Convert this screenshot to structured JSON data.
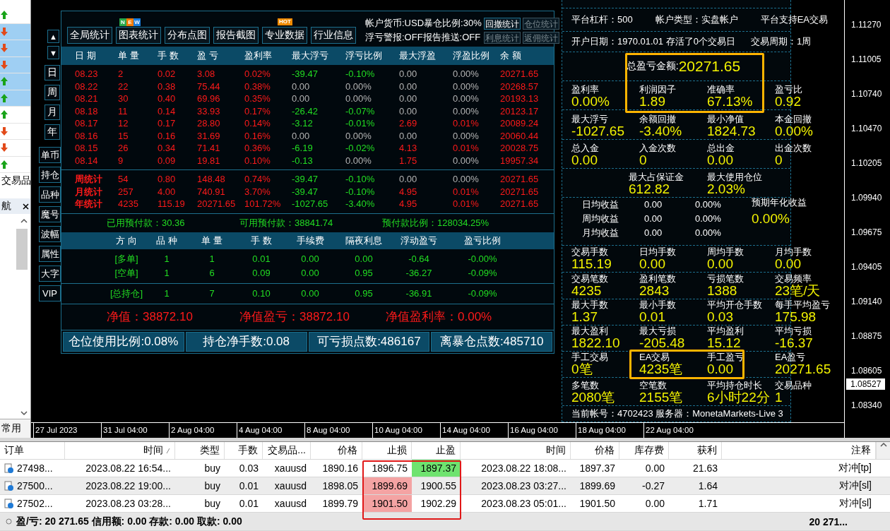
{
  "market_rows": [
    {
      "kind": "up",
      "selected": false
    },
    {
      "kind": "down",
      "selected": true
    },
    {
      "kind": "down",
      "selected": true
    },
    {
      "kind": "down",
      "selected": true
    },
    {
      "kind": "up",
      "selected": true
    },
    {
      "kind": "up",
      "selected": true
    },
    {
      "kind": "up",
      "selected": false
    },
    {
      "kind": "down",
      "selected": false
    },
    {
      "kind": "down",
      "selected": false
    },
    {
      "kind": "up",
      "selected": false
    }
  ],
  "navigator": {
    "symbols_tab": "交易品",
    "nav_tab": "航",
    "bottom_tab": "常用"
  },
  "scroll_buttons": [
    "▲",
    "▼"
  ],
  "period_tabs": [
    "日",
    "周",
    "月",
    "年"
  ],
  "view_tabs": [
    "单币",
    "持仓",
    "品种",
    "魔号",
    "波幅",
    "属性",
    "大字",
    "VIP"
  ],
  "toolbar": [
    {
      "label": "全局统计"
    },
    {
      "label": "图表统计",
      "badge": {
        "kind": "new",
        "letters": [
          {
            "text": "N",
            "color": "#2aa84a"
          },
          {
            "text": "E",
            "color": "#f07a00"
          },
          {
            "text": "W",
            "color": "#1a7fe0"
          }
        ]
      }
    },
    {
      "label": "分布点图"
    },
    {
      "label": "报告截图"
    },
    {
      "label": "专业数据",
      "badge": {
        "kind": "hot",
        "text": "HOT"
      }
    },
    {
      "label": "行业信息"
    }
  ],
  "account_info": [
    "帐户货币:USD暴仓比例:30%",
    "浮亏警报:OFF报告推送:OFF"
  ],
  "report_buttons": [
    {
      "label": "回撤统计",
      "disabled": false
    },
    {
      "label": "仓位统计",
      "disabled": true
    },
    {
      "label": "利息统计",
      "disabled": true
    },
    {
      "label": "返佣统计",
      "disabled": true
    }
  ],
  "stats": {
    "columns": [
      "日 期",
      "单 量",
      "手 数",
      "盈 亏",
      "盈利率",
      "最大浮亏",
      "浮亏比例",
      "最大浮盈",
      "浮盈比例",
      "余 额"
    ],
    "daily": [
      [
        {
          "text": "08.23",
          "color": "#ff1a1a"
        },
        {
          "text": "2",
          "color": "#ff1a1a"
        },
        {
          "text": "0.02",
          "color": "#ff1a1a"
        },
        {
          "text": "3.08",
          "color": "#ff1a1a"
        },
        {
          "text": "0.02%",
          "color": "#ff1a1a"
        },
        {
          "text": "-39.47",
          "color": "#22dd22"
        },
        {
          "text": "-0.10%",
          "color": "#22dd22"
        },
        {
          "text": "0.00",
          "color": "#b4b4b4"
        },
        {
          "text": "0.00%",
          "color": "#b4b4b4"
        },
        {
          "text": "20271.65",
          "color": "#ff1a1a"
        }
      ],
      [
        {
          "text": "08.22",
          "color": "#ff1a1a"
        },
        {
          "text": "22",
          "color": "#ff1a1a"
        },
        {
          "text": "0.38",
          "color": "#ff1a1a"
        },
        {
          "text": "75.44",
          "color": "#ff1a1a"
        },
        {
          "text": "0.38%",
          "color": "#ff1a1a"
        },
        {
          "text": "0.00",
          "color": "#b4b4b4"
        },
        {
          "text": "0.00%",
          "color": "#b4b4b4"
        },
        {
          "text": "0.00",
          "color": "#b4b4b4"
        },
        {
          "text": "0.00%",
          "color": "#b4b4b4"
        },
        {
          "text": "20268.57",
          "color": "#ff1a1a"
        }
      ],
      [
        {
          "text": "08.21",
          "color": "#ff1a1a"
        },
        {
          "text": "30",
          "color": "#ff1a1a"
        },
        {
          "text": "0.40",
          "color": "#ff1a1a"
        },
        {
          "text": "69.96",
          "color": "#ff1a1a"
        },
        {
          "text": "0.35%",
          "color": "#ff1a1a"
        },
        {
          "text": "0.00",
          "color": "#b4b4b4"
        },
        {
          "text": "0.00%",
          "color": "#b4b4b4"
        },
        {
          "text": "0.00",
          "color": "#b4b4b4"
        },
        {
          "text": "0.00%",
          "color": "#b4b4b4"
        },
        {
          "text": "20193.13",
          "color": "#ff1a1a"
        }
      ],
      [
        {
          "text": "08.18",
          "color": "#ff1a1a"
        },
        {
          "text": "11",
          "color": "#ff1a1a"
        },
        {
          "text": "0.14",
          "color": "#ff1a1a"
        },
        {
          "text": "33.93",
          "color": "#ff1a1a"
        },
        {
          "text": "0.17%",
          "color": "#ff1a1a"
        },
        {
          "text": "-26.42",
          "color": "#22dd22"
        },
        {
          "text": "-0.07%",
          "color": "#22dd22"
        },
        {
          "text": "0.00",
          "color": "#b4b4b4"
        },
        {
          "text": "0.00%",
          "color": "#b4b4b4"
        },
        {
          "text": "20123.17",
          "color": "#ff1a1a"
        }
      ],
      [
        {
          "text": "08.17",
          "color": "#ff1a1a"
        },
        {
          "text": "12",
          "color": "#ff1a1a"
        },
        {
          "text": "0.17",
          "color": "#ff1a1a"
        },
        {
          "text": "28.80",
          "color": "#ff1a1a"
        },
        {
          "text": "0.14%",
          "color": "#ff1a1a"
        },
        {
          "text": "-3.12",
          "color": "#22dd22"
        },
        {
          "text": "-0.01%",
          "color": "#22dd22"
        },
        {
          "text": "2.69",
          "color": "#ff1a1a"
        },
        {
          "text": "0.01%",
          "color": "#ff1a1a"
        },
        {
          "text": "20089.24",
          "color": "#ff1a1a"
        }
      ],
      [
        {
          "text": "08.16",
          "color": "#ff1a1a"
        },
        {
          "text": "15",
          "color": "#ff1a1a"
        },
        {
          "text": "0.16",
          "color": "#ff1a1a"
        },
        {
          "text": "31.69",
          "color": "#ff1a1a"
        },
        {
          "text": "0.16%",
          "color": "#ff1a1a"
        },
        {
          "text": "0.00",
          "color": "#b4b4b4"
        },
        {
          "text": "0.00%",
          "color": "#b4b4b4"
        },
        {
          "text": "0.00",
          "color": "#b4b4b4"
        },
        {
          "text": "0.00%",
          "color": "#b4b4b4"
        },
        {
          "text": "20060.44",
          "color": "#ff1a1a"
        }
      ],
      [
        {
          "text": "08.15",
          "color": "#ff1a1a"
        },
        {
          "text": "26",
          "color": "#ff1a1a"
        },
        {
          "text": "0.34",
          "color": "#ff1a1a"
        },
        {
          "text": "71.41",
          "color": "#ff1a1a"
        },
        {
          "text": "0.36%",
          "color": "#ff1a1a"
        },
        {
          "text": "-6.19",
          "color": "#22dd22"
        },
        {
          "text": "-0.02%",
          "color": "#22dd22"
        },
        {
          "text": "4.13",
          "color": "#ff1a1a"
        },
        {
          "text": "0.01%",
          "color": "#ff1a1a"
        },
        {
          "text": "20028.75",
          "color": "#ff1a1a"
        }
      ],
      [
        {
          "text": "08.14",
          "color": "#ff1a1a"
        },
        {
          "text": "9",
          "color": "#ff1a1a"
        },
        {
          "text": "0.09",
          "color": "#ff1a1a"
        },
        {
          "text": "19.81",
          "color": "#ff1a1a"
        },
        {
          "text": "0.10%",
          "color": "#ff1a1a"
        },
        {
          "text": "-0.13",
          "color": "#22dd22"
        },
        {
          "text": "0.00%",
          "color": "#b4b4b4"
        },
        {
          "text": "1.75",
          "color": "#ff1a1a"
        },
        {
          "text": "0.00%",
          "color": "#b4b4b4"
        },
        {
          "text": "19957.34",
          "color": "#ff1a1a"
        }
      ]
    ],
    "summary": [
      [
        {
          "text": "周统计",
          "color": "#ff1a1a"
        },
        {
          "text": "54",
          "color": "#ff1a1a"
        },
        {
          "text": "0.80",
          "color": "#ff1a1a"
        },
        {
          "text": "148.48",
          "color": "#ff1a1a"
        },
        {
          "text": "0.74%",
          "color": "#ff1a1a"
        },
        {
          "text": "-39.47",
          "color": "#22dd22"
        },
        {
          "text": "-0.10%",
          "color": "#22dd22"
        },
        {
          "text": "0.00",
          "color": "#b4b4b4"
        },
        {
          "text": "0.00%",
          "color": "#b4b4b4"
        },
        {
          "text": "20271.65",
          "color": "#ff1a1a"
        }
      ],
      [
        {
          "text": "月统计",
          "color": "#ff1a1a"
        },
        {
          "text": "257",
          "color": "#ff1a1a"
        },
        {
          "text": "4.00",
          "color": "#ff1a1a"
        },
        {
          "text": "740.91",
          "color": "#ff1a1a"
        },
        {
          "text": "3.70%",
          "color": "#ff1a1a"
        },
        {
          "text": "-39.47",
          "color": "#22dd22"
        },
        {
          "text": "-0.10%",
          "color": "#22dd22"
        },
        {
          "text": "4.95",
          "color": "#ff1a1a"
        },
        {
          "text": "0.01%",
          "color": "#ff1a1a"
        },
        {
          "text": "20271.65",
          "color": "#ff1a1a"
        }
      ],
      [
        {
          "text": "年统计",
          "color": "#ff1a1a"
        },
        {
          "text": "4235",
          "color": "#ff1a1a"
        },
        {
          "text": "115.19",
          "color": "#ff1a1a"
        },
        {
          "text": "20271.65",
          "color": "#ff1a1a"
        },
        {
          "text": "101.72%",
          "color": "#ff1a1a"
        },
        {
          "text": "-1027.65",
          "color": "#22dd22"
        },
        {
          "text": "-3.40%",
          "color": "#22dd22"
        },
        {
          "text": "4.95",
          "color": "#ff1a1a"
        },
        {
          "text": "0.01%",
          "color": "#ff1a1a"
        },
        {
          "text": "20271.65",
          "color": "#ff1a1a"
        }
      ]
    ]
  },
  "margin": [
    "已用预付款：30.36",
    "可用预付款：38841.74",
    "预付款比例：128034.25%"
  ],
  "positions": {
    "columns": [
      "方 向",
      "品 种",
      "单 量",
      "手 数",
      "手续费",
      "隔夜利息",
      "浮动盈亏",
      "盈亏比例"
    ],
    "rows": [
      [
        "[多单]",
        "1",
        "1",
        "0.01",
        "0.00",
        "0.00",
        "-0.64",
        "-0.00%"
      ],
      [
        "[空单]",
        "1",
        "6",
        "0.09",
        "0.00",
        "0.95",
        "-36.27",
        "-0.09%"
      ]
    ],
    "total": [
      "[总持仓]",
      "1",
      "7",
      "0.10",
      "0.00",
      "0.95",
      "-36.91",
      "-0.09%"
    ]
  },
  "equity": [
    "净值：38872.10",
    "净值盈亏：38872.10",
    "净值盈利率：0.00%"
  ],
  "gauges": [
    "仓位使用比例:0.08%",
    "持仓净手数:0.08",
    "可亏损点数:486167",
    "离暴仓点数:485710"
  ],
  "right_panel": {
    "platform": [
      "平台杠杆：500",
      "帐户类型：实盘帐户",
      "平台支持EA交易"
    ],
    "account_age": [
      "开户日期：1970.01.01 存活了0个交易日",
      "交易周期：1周"
    ],
    "total": {
      "label": "总盈亏金额:",
      "value": "20271.65"
    },
    "metric_rows": [
      [
        {
          "label": "盈利率",
          "value": "0.00%"
        },
        {
          "label": "利润因子",
          "value": "1.89"
        },
        {
          "label": "准确率",
          "value": "67.13%"
        },
        {
          "label": "盈亏比",
          "value": "0.92"
        }
      ],
      [
        {
          "label": "最大浮亏",
          "value": "-1027.65"
        },
        {
          "label": "余额回撤",
          "value": "-3.40%"
        },
        {
          "label": "最小净值",
          "value": "1824.73"
        },
        {
          "label": "本金回撤",
          "value": "0.00%"
        }
      ],
      [
        {
          "label": "总入金",
          "value": "0.00"
        },
        {
          "label": "入金次数",
          "value": "0"
        },
        {
          "label": "总出金",
          "value": "0.00"
        },
        {
          "label": "出金次数",
          "value": "0"
        }
      ]
    ],
    "margin_row": [
      {
        "label": "最大占保证金",
        "value": "612.82"
      },
      {
        "label": "最大使用仓位",
        "value": "2.03%"
      }
    ],
    "earnings": {
      "rows": [
        [
          "日均收益",
          "0.00",
          "0.00%"
        ],
        [
          "周均收益",
          "0.00",
          "0.00%"
        ],
        [
          "月均收益",
          "0.00",
          "0.00%"
        ]
      ],
      "forecast": {
        "label": "预期年化收益",
        "value": "0.00%"
      }
    },
    "trade_rows": [
      [
        {
          "label": "交易手数",
          "value": "115.19"
        },
        {
          "label": "日均手数",
          "value": "0.00"
        },
        {
          "label": "周均手数",
          "value": "0.00"
        },
        {
          "label": "月均手数",
          "value": "0.00"
        }
      ],
      [
        {
          "label": "交易笔数",
          "value": "4235"
        },
        {
          "label": "盈利笔数",
          "value": "2843"
        },
        {
          "label": "亏损笔数",
          "value": "1388"
        },
        {
          "label": "交易频率",
          "value": "23笔/天"
        }
      ],
      [
        {
          "label": "最大手数",
          "value": "1.37"
        },
        {
          "label": "最小手数",
          "value": "0.01"
        },
        {
          "label": "平均开仓手数",
          "value": "0.03"
        },
        {
          "label": "每手平均盈亏",
          "value": "175.98"
        }
      ],
      [
        {
          "label": "最大盈利",
          "value": "1822.10"
        },
        {
          "label": "最大亏损",
          "value": "-205.48"
        },
        {
          "label": "平均盈利",
          "value": "15.12"
        },
        {
          "label": "平均亏损",
          "value": "-16.37"
        }
      ],
      [
        {
          "label": "手工交易",
          "value": "0笔"
        },
        {
          "label": "EA交易",
          "value": "4235笔"
        },
        {
          "label": "手工盈亏",
          "value": "0.00"
        },
        {
          "label": "EA盈亏",
          "value": "20271.65"
        }
      ],
      [
        {
          "label": "多笔数",
          "value": "2080笔"
        },
        {
          "label": "空笔数",
          "value": "2155笔"
        },
        {
          "label": "平均持仓时长",
          "value": "6小时22分"
        },
        {
          "label": "交易品种",
          "value": "1"
        }
      ]
    ],
    "account": "当前帐号：4702423 服务器：MonetaMarkets-Live 3",
    "highlight_frames": [
      {
        "color": "#ffb400"
      },
      {
        "color": "#ffb400"
      }
    ]
  },
  "price_axis": {
    "labels": [
      "1.11270",
      "1.11005",
      "1.10740",
      "1.10470",
      "1.10205",
      "1.09940",
      "1.09675",
      "1.09405",
      "1.09140",
      "1.08875",
      "1.08605",
      "1.08340"
    ],
    "current": "1.08527"
  },
  "time_axis": [
    "27 Jul 2023",
    "31 Jul 04:00",
    "2 Aug 04:00",
    "4 Aug 04:00",
    "8 Aug 04:00",
    "10 Aug 04:00",
    "14 Aug 04:00",
    "16 Aug 04:00",
    "18 Aug 04:00",
    "22 Aug 04:00"
  ],
  "orders": {
    "columns": [
      {
        "label": "订单"
      },
      {
        "label": "时间",
        "sorted": true
      },
      {
        "label": "类型"
      },
      {
        "label": "手数"
      },
      {
        "label": "交易品..."
      },
      {
        "label": "价格"
      },
      {
        "label": "止损"
      },
      {
        "label": "止盈"
      },
      {
        "label": "时间"
      },
      {
        "label": "价格"
      },
      {
        "label": "库存费"
      },
      {
        "label": "获利"
      },
      {
        "label": "注释"
      }
    ],
    "rows": [
      {
        "cells": [
          "27498...",
          "2023.08.22 16:54...",
          "buy",
          "0.03",
          "xauusd",
          "1890.16",
          "1896.75",
          "1897.37",
          "2023.08.22 18:08...",
          "1897.37",
          "0.00",
          "21.63",
          "对冲[tp]"
        ],
        "sl_hit": false,
        "tp_hit": true
      },
      {
        "cells": [
          "27500...",
          "2023.08.22 19:00...",
          "buy",
          "0.01",
          "xauusd",
          "1898.05",
          "1899.69",
          "1900.55",
          "2023.08.23 03:27...",
          "1899.69",
          "-0.27",
          "1.64",
          "对冲[sl]"
        ],
        "sl_hit": true,
        "tp_hit": false
      },
      {
        "cells": [
          "27502...",
          "2023.08.23 03:28...",
          "buy",
          "0.01",
          "xauusd",
          "1899.79",
          "1901.50",
          "1902.29",
          "2023.08.23 05:01...",
          "1901.50",
          "0.00",
          "1.71",
          "对冲[sl]"
        ],
        "sl_hit": true,
        "tp_hit": false
      }
    ],
    "highlight_frame": {
      "color": "#e01818"
    },
    "summary": "盈/亏: 20 271.65 信用额: 0.00 存款: 0.00 取款: 0.00",
    "total": "20 271..."
  }
}
